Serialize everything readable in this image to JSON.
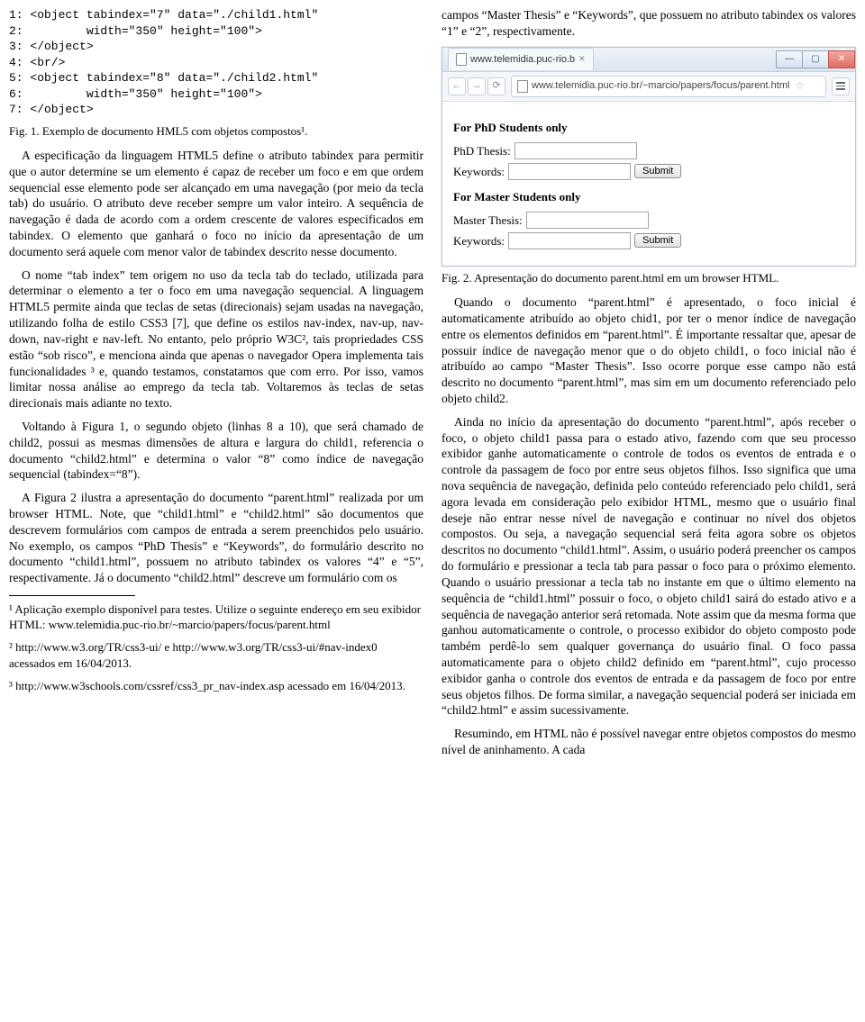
{
  "left": {
    "code": {
      "l1": "1: <object tabindex=\"7\" data=\"./child1.html\"",
      "l2": "2:         width=\"350\" height=\"100\">",
      "l3": "3: </object>",
      "l4": "4: <br/>",
      "l5": "5: <object tabindex=\"8\" data=\"./child2.html\"",
      "l6": "6:         width=\"350\" height=\"100\">",
      "l7": "7: </object>"
    },
    "fig1_caption": "Fig. 1.   Exemplo de documento HML5 com objetos compostos¹.",
    "para1": "A especificação da linguagem HTML5 define o atributo tabindex para permitir que o autor determine se um elemento é capaz de receber um foco e em que ordem sequencial esse elemento pode ser alcançado em uma navegação (por meio da tecla tab) do usuário. O atributo deve receber sempre um valor inteiro. A sequência de navegação é dada de acordo com a ordem crescente de valores especificados em tabindex. O elemento que ganhará o foco no início da apresentação de um documento será aquele com menor valor de tabindex descrito nesse documento.",
    "para2": "O nome “tab index” tem origem no uso da tecla tab do teclado, utilizada para determinar o elemento a ter o foco em uma navegação sequencial. A linguagem HTML5 permite ainda que teclas de setas (direcionais) sejam usadas na navegação, utilizando folha de estilo CSS3 [7], que define os estilos nav-index, nav-up, nav-down, nav-right e nav-left. No entanto, pelo próprio W3C², tais propriedades CSS estão “sob risco”, e menciona ainda que apenas o navegador Opera implementa tais funcionalidades ³ e, quando testamos, constatamos que com erro. Por isso, vamos limitar nossa análise ao emprego da tecla tab. Voltaremos às teclas de setas direcionais mais adiante no texto.",
    "para3": "Voltando à Figura 1, o segundo objeto (linhas 8 a 10), que será chamado de child2, possui as mesmas dimensões de altura e largura do child1, referencia o documento “child2.html” e determina o valor “8” como índice de navegação sequencial (tabindex=“8”).",
    "para4": "A Figura 2 ilustra a apresentação do documento “parent.html” realizada por um browser HTML. Note, que “child1.html” e “child2.html” são documentos que descrevem formulários com campos de entrada a serem preenchidos pelo usuário. No exemplo, os campos “PhD Thesis” e “Keywords”, do formulário descrito no documento “child1.html”, possuem no atributo tabindex os valores “4” e “5”, respectivamente. Já o documento “child2.html” descreve um formulário com os",
    "footnotes": {
      "f1": "¹ Aplicação exemplo disponível para testes. Utilize o seguinte endereço em seu exibidor HTML: www.telemidia.puc-rio.br/~marcio/papers/focus/parent.html",
      "f2": "² http://www.w3.org/TR/css3-ui/ e http://www.w3.org/TR/css3-ui/#nav-index0 acessados em 16/04/2013.",
      "f3": "³ http://www.w3schools.com/cssref/css3_pr_nav-index.asp acessado em 16/04/2013."
    }
  },
  "right": {
    "para0": "campos “Master Thesis” e “Keywords”, que possuem no atributo tabindex os valores “1” e “2”, respectivamente.",
    "browser": {
      "tab_title": "www.telemidia.puc-rio.b",
      "url": "www.telemidia.puc-rio.br/~marcio/papers/focus/parent.html",
      "section1": "For PhD Students only",
      "label_phd": "PhD Thesis:",
      "label_keywords": "Keywords:",
      "section2": "For Master Students only",
      "label_master": "Master Thesis:",
      "submit": "Submit"
    },
    "fig2_caption": "Fig. 2.   Apresentação do documento parent.html em um browser HTML.",
    "para1": "Quando o documento “parent.html” é apresentado, o foco inicial é automaticamente atribuído ao objeto chid1, por ter o menor índice de navegação entre os elementos definidos em “parent.html”. É importante ressaltar que, apesar de possuir índice de navegação menor que o do objeto child1, o foco inicial não é atribuído ao campo “Master Thesis”. Isso ocorre porque esse campo não está descrito no documento “parent.html”, mas sim em um documento referenciado pelo objeto child2.",
    "para2": "Ainda no início da apresentação do documento “parent.html”, após receber o foco, o objeto child1 passa para o estado ativo, fazendo com que seu processo exibidor ganhe automaticamente o controle de todos os eventos de entrada e o controle da passagem de foco por entre seus objetos filhos. Isso significa que uma nova sequência de navegação, definida pelo conteúdo referenciado pelo child1, será agora levada em consideração pelo exibidor HTML, mesmo que o usuário final deseje não entrar nesse nível de navegação e continuar no nível dos objetos compostos. Ou seja, a navegação sequencial será feita agora sobre os objetos descritos no documento “child1.html”. Assim, o usuário poderá preencher os campos do formulário e pressionar a tecla tab para passar o foco para o próximo elemento. Quando o usuário pressionar a tecla tab no instante em que o último elemento na sequência de “child1.html” possuir o foco, o objeto child1 sairá do estado ativo e a sequência de navegação anterior será retomada. Note assim que da mesma forma que ganhou automaticamente o controle, o processo exibidor do objeto composto pode também perdê-lo sem qualquer governança do usuário final. O foco passa automaticamente para o objeto child2 definido em “parent.html”, cujo processo exibidor ganha o controle dos eventos de entrada e da passagem de foco por entre seus objetos filhos. De forma similar, a navegação sequencial poderá ser iniciada em “child2.html” e assim sucessivamente.",
    "para3": "Resumindo, em HTML não é possível navegar entre objetos compostos do mesmo nível de aninhamento. A cada"
  }
}
